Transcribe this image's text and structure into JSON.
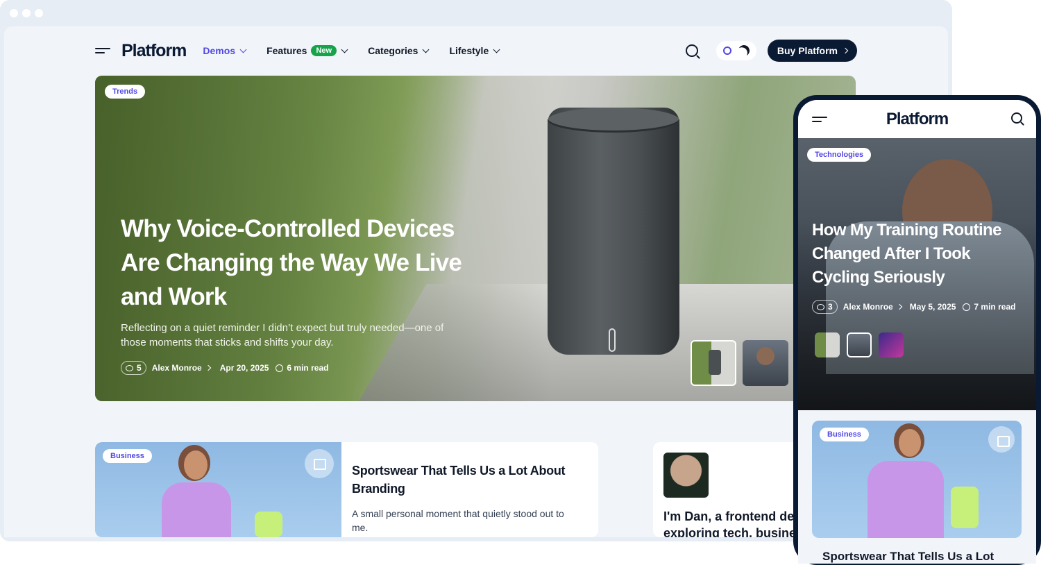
{
  "desktop": {
    "header": {
      "logo": "Platform",
      "nav": [
        {
          "label": "Demos",
          "active": true
        },
        {
          "label": "Features",
          "badge": "New"
        },
        {
          "label": "Categories"
        },
        {
          "label": "Lifestyle"
        }
      ],
      "buy_label": "Buy Platform"
    },
    "hero": {
      "tag": "Trends",
      "title": "Why Voice-Controlled Devices Are Changing the Way We Live and Work",
      "subtitle": "Reflecting on a quiet reminder I didn’t expect but truly needed—one of those moments that sticks and shifts your day.",
      "comments": "5",
      "author": "Alex Monroe",
      "date": "Apr 20, 2025",
      "read_time": "6 min read"
    },
    "card1": {
      "tag": "Business",
      "title": "Sportswear That Tells Us a Lot About Branding",
      "subtitle": "A small personal moment that quietly stood out to me."
    },
    "card2": {
      "text_line1": "I'm Dan, a frontend dev",
      "text_line2": "exploring tech, busine"
    }
  },
  "mobile": {
    "logo": "Platform",
    "hero": {
      "tag": "Technologies",
      "title": "How My Training Routine Changed After I Took Cycling Seriously",
      "comments": "3",
      "author": "Alex Monroe",
      "date": "May 5, 2025",
      "read_time": "7 min read"
    },
    "card": {
      "tag": "Business",
      "title": "Sportswear That Tells Us a Lot"
    }
  },
  "colors": {
    "accent": "#5146e5",
    "navy": "#0b1a33",
    "badge_green": "#16a34a"
  }
}
